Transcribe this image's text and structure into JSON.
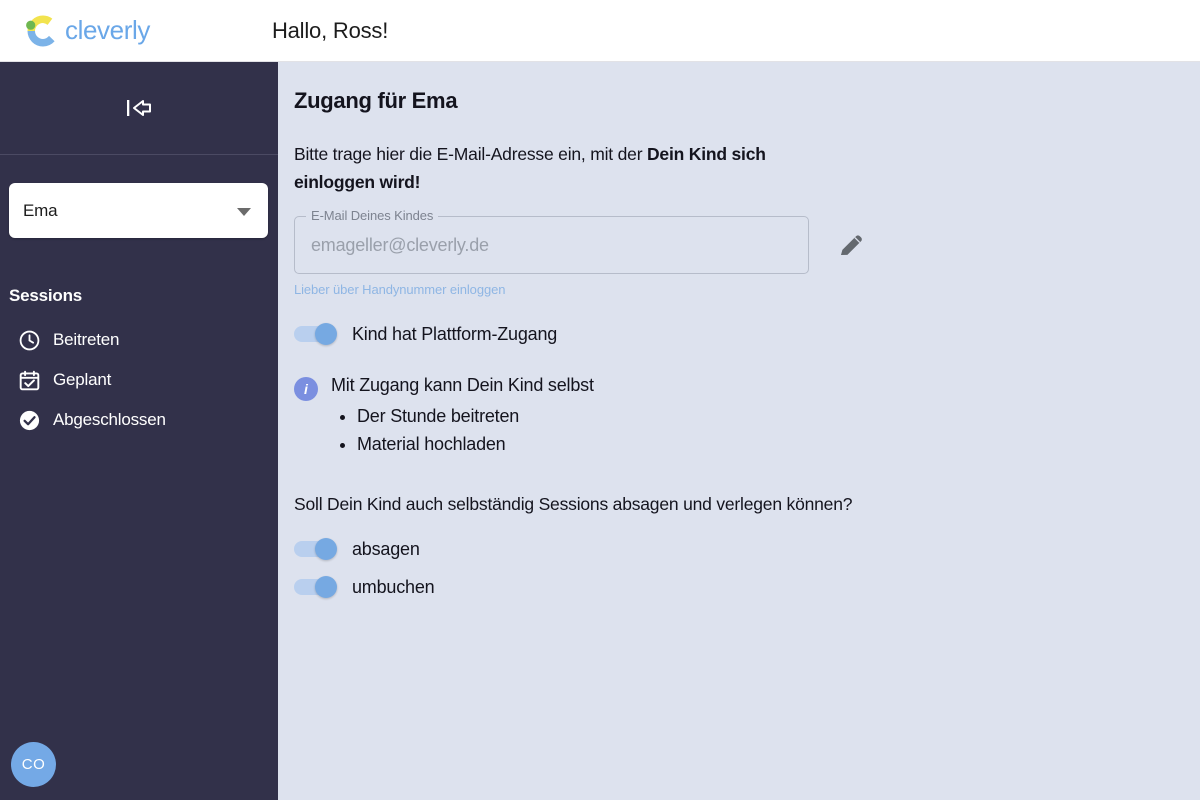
{
  "header": {
    "logo_text": "cleverly",
    "logo_icon": "cleverly-c-logo",
    "greeting": "Hallo, Ross!"
  },
  "sidebar": {
    "collapse_icon": "collapse-left-arrow-icon",
    "child_select": {
      "value": "Ema",
      "chevron_icon": "chevron-down-icon"
    },
    "section_title": "Sessions",
    "nav_items": [
      {
        "label": "Beitreten",
        "icon": "clock-icon"
      },
      {
        "label": "Geplant",
        "icon": "calendar-check-icon"
      },
      {
        "label": "Abgeschlossen",
        "icon": "check-circle-icon"
      }
    ],
    "avatar_initials": "CO"
  },
  "main": {
    "page_title": "Zugang für Ema",
    "intro": {
      "part1": "Bitte trage hier die E-Mail-Adresse ein, mit der ",
      "bold": "Dein Kind sich einloggen wird!"
    },
    "email_field": {
      "legend": "E-Mail Deines Kindes",
      "value": "emageller@cleverly.de",
      "placeholder": "emageller@cleverly.de",
      "edit_icon": "pencil-icon"
    },
    "helper_link": "Lieber über Handynummer einloggen",
    "platform_toggle": {
      "label": "Kind hat Plattform-Zugang",
      "state": "on"
    },
    "info": {
      "icon": "info-icon",
      "title": "Mit Zugang kann Dein Kind selbst",
      "items": [
        "Der Stunde beitreten",
        "Material hochladen"
      ]
    },
    "question": "Soll Dein Kind auch selbständig Sessions absagen und verlegen können?",
    "permission_toggles": [
      {
        "label": "absagen",
        "state": "on"
      },
      {
        "label": "umbuchen",
        "state": "on"
      }
    ]
  },
  "colors": {
    "sidebar_bg": "#32314a",
    "main_bg": "#dde2ee",
    "accent_blue": "#74a9e6",
    "toggle_track": "#b9cfee",
    "toggle_thumb": "#76a9e2",
    "info_icon": "#7b8fe0",
    "link_blue": "#8fb6e4",
    "logo_blue": "#6aa7e8",
    "logo_yellow": "#f2e34e",
    "logo_green": "#6fb750"
  }
}
